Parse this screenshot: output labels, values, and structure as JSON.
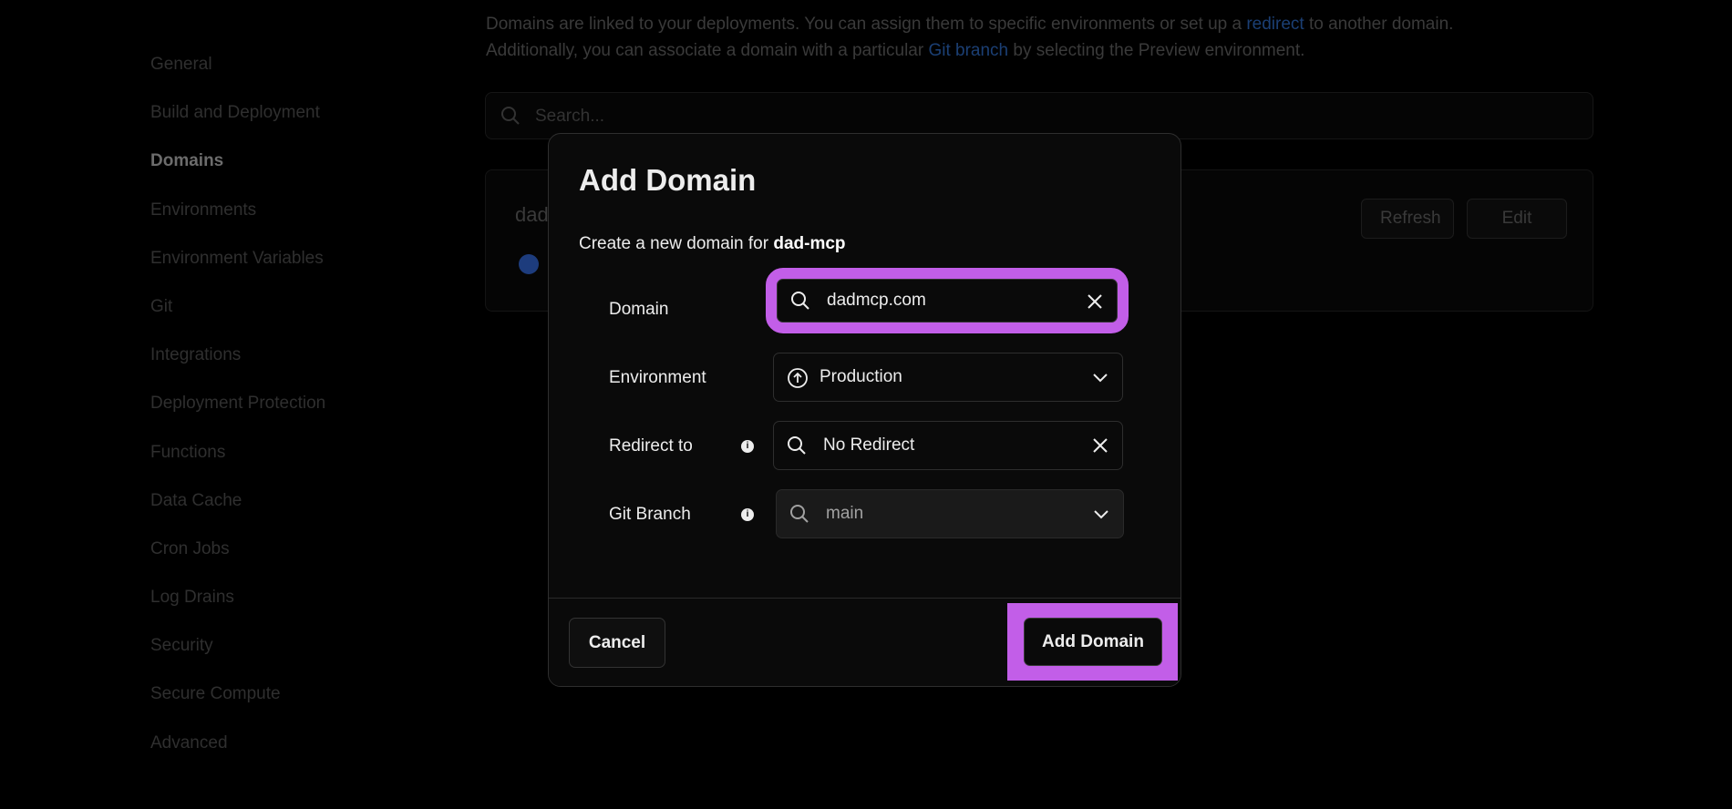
{
  "sidebar": {
    "items": [
      {
        "label": "General"
      },
      {
        "label": "Build and Deployment"
      },
      {
        "label": "Domains"
      },
      {
        "label": "Environments"
      },
      {
        "label": "Environment Variables"
      },
      {
        "label": "Git"
      },
      {
        "label": "Integrations"
      },
      {
        "label": "Deployment Protection"
      },
      {
        "label": "Functions"
      },
      {
        "label": "Data Cache"
      },
      {
        "label": "Cron Jobs"
      },
      {
        "label": "Log Drains"
      },
      {
        "label": "Security"
      },
      {
        "label": "Secure Compute"
      },
      {
        "label": "Advanced"
      }
    ],
    "active": "Domains"
  },
  "main": {
    "intro": {
      "line1_before": "Domains are linked to your deployments. You can assign them to specific environments or set up a ",
      "line1_link": "redirect",
      "line1_after": " to another domain.",
      "line2_before": "Additionally, you can associate a domain with a particular ",
      "line2_link": "Git branch",
      "line2_after": " by selecting the Preview environment."
    },
    "search": {
      "placeholder": "Search..."
    },
    "card": {
      "title": "dad",
      "refresh_label": "Refresh",
      "edit_label": "Edit"
    }
  },
  "modal": {
    "title": "Add Domain",
    "subtitle_prefix": "Create a new domain for ",
    "project_name": "dad-mcp",
    "fields": {
      "domain": {
        "label": "Domain",
        "value": "dadmcp.com"
      },
      "environment": {
        "label": "Environment",
        "value": "Production"
      },
      "redirect": {
        "label": "Redirect to",
        "value": "No Redirect"
      },
      "branch": {
        "label": "Git Branch",
        "value": "main"
      }
    },
    "cancel_label": "Cancel",
    "submit_label": "Add Domain"
  },
  "colors": {
    "highlight": "#c25ee8",
    "link": "#1b3f74",
    "check": "#1d3c7d"
  }
}
